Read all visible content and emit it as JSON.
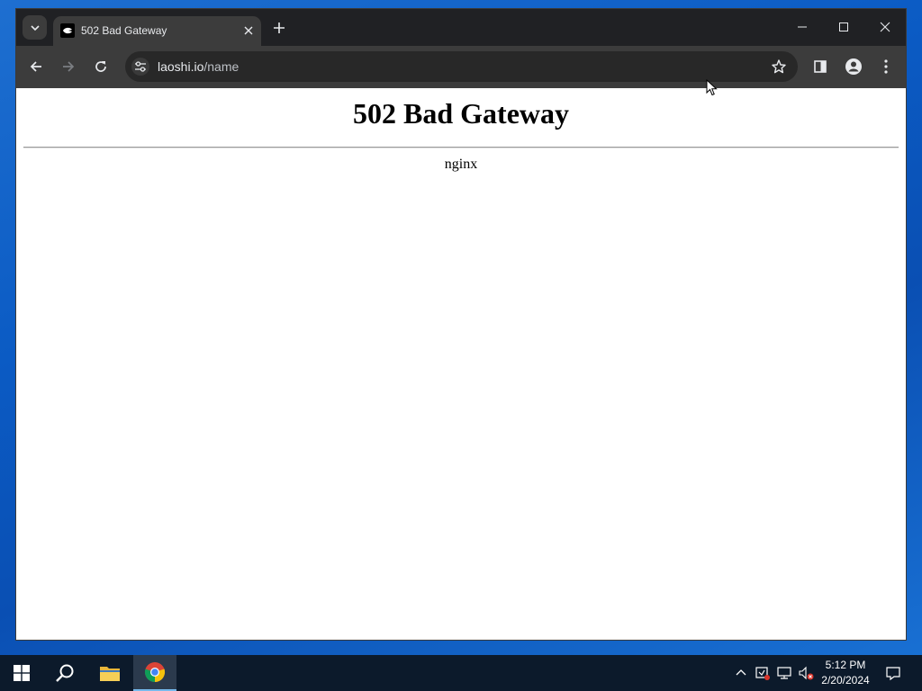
{
  "browser": {
    "tab": {
      "title": "502 Bad Gateway"
    },
    "address_bar": {
      "host": "laoshi.io",
      "path": "/name"
    }
  },
  "page": {
    "heading": "502 Bad Gateway",
    "server": "nginx"
  },
  "taskbar": {
    "time": "5:12 PM",
    "date": "2/20/2024"
  },
  "icons": {
    "tab_search": "chevron-down-icon",
    "close": "close-icon",
    "new_tab": "plus-icon",
    "back": "arrow-left-icon",
    "forward": "arrow-right-icon",
    "reload": "reload-icon",
    "site_info": "tune-icon",
    "bookmark": "star-icon",
    "side_panel": "side-panel-icon",
    "profile": "profile-icon",
    "menu": "kebab-menu-icon"
  },
  "colors": {
    "tabstrip": "#202124",
    "toolbar": "#3c3c3c",
    "omnibox": "#282828",
    "desktop": "#0b5bc4",
    "taskbar": "#0c1a2b"
  }
}
